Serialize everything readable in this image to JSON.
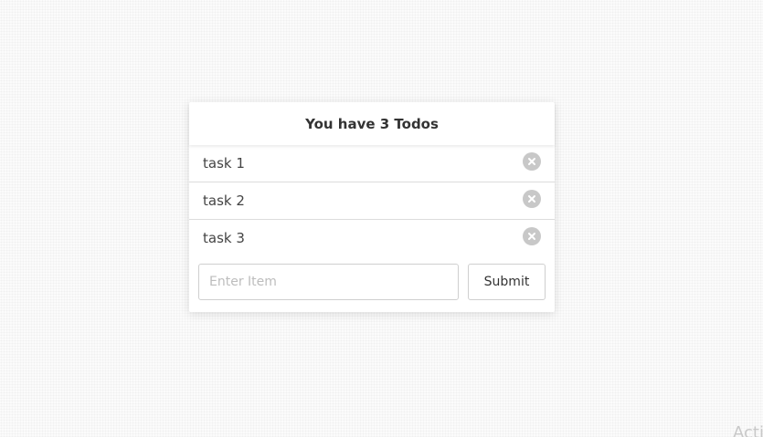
{
  "todo_app": {
    "header": {
      "title": "You have 3 Todos"
    },
    "items": [
      {
        "label": "task 1",
        "remove_icon": "close-circle-icon"
      },
      {
        "label": "task 2",
        "remove_icon": "close-circle-icon"
      },
      {
        "label": "task 3",
        "remove_icon": "close-circle-icon"
      }
    ],
    "input": {
      "value": "",
      "placeholder": "Enter Item"
    },
    "submit_label": "Submit"
  },
  "watermark": {
    "text": "Acti"
  },
  "colors": {
    "card_background": "#ffffff",
    "remove_icon": "#c8c8c8",
    "border": "#cfcfcf"
  }
}
